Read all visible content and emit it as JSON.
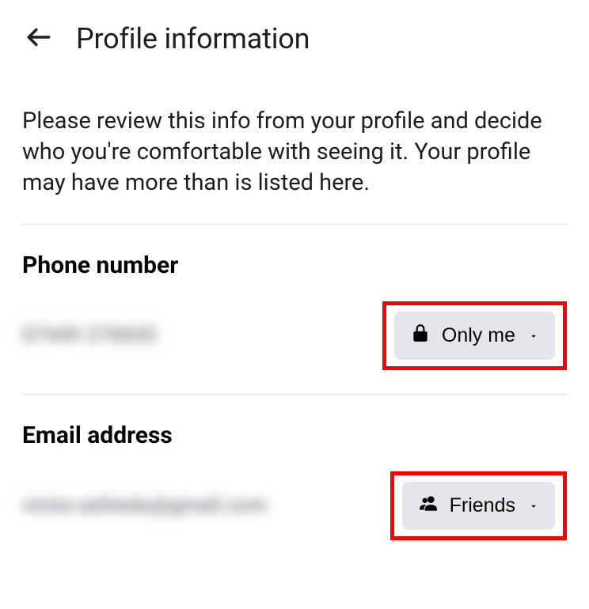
{
  "header": {
    "title": "Profile information"
  },
  "description": "Please review this info from your profile and decide who you're comfortable with seeing it. Your profile may have more than is listed here.",
  "sections": {
    "phone": {
      "title": "Phone number",
      "value": "07449 270655",
      "privacy": "Only me"
    },
    "email": {
      "title": "Email address",
      "value": "victor.ashiedu@gmail.com",
      "privacy": "Friends"
    }
  }
}
